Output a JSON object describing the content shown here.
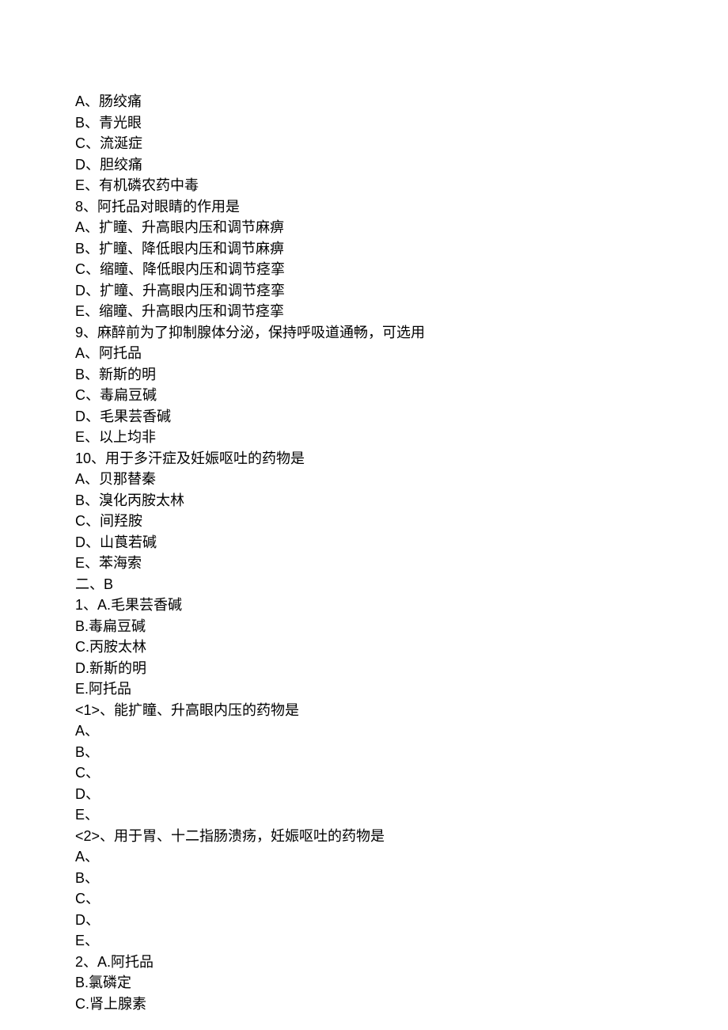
{
  "lines": [
    {
      "prefix": "A、",
      "text": "肠绞痛"
    },
    {
      "prefix": "B、",
      "text": "青光眼"
    },
    {
      "prefix": "C、",
      "text": "流涎症"
    },
    {
      "prefix": "D、",
      "text": "胆绞痛"
    },
    {
      "prefix": "E、",
      "text": "有机磷农药中毒"
    },
    {
      "prefix": "8、",
      "text": "阿托品对眼睛的作用是"
    },
    {
      "prefix": "A、",
      "text": "扩瞳、升高眼内压和调节麻痹"
    },
    {
      "prefix": "B、",
      "text": "扩瞳、降低眼内压和调节麻痹"
    },
    {
      "prefix": "C、",
      "text": "缩瞳、降低眼内压和调节痉挛"
    },
    {
      "prefix": "D、",
      "text": "扩瞳、升高眼内压和调节痉挛"
    },
    {
      "prefix": "E、",
      "text": "缩瞳、升高眼内压和调节痉挛"
    },
    {
      "prefix": "9、",
      "text": "麻醉前为了抑制腺体分泌，保持呼吸道通畅，可选用"
    },
    {
      "prefix": "A、",
      "text": "阿托品"
    },
    {
      "prefix": "B、",
      "text": "新斯的明"
    },
    {
      "prefix": "C、",
      "text": "毒扁豆碱"
    },
    {
      "prefix": "D、",
      "text": "毛果芸香碱"
    },
    {
      "prefix": "E、",
      "text": "以上均非"
    },
    {
      "prefix": "10、",
      "text": "用于多汗症及妊娠呕吐的药物是"
    },
    {
      "prefix": "A、",
      "text": "贝那替秦"
    },
    {
      "prefix": "B、",
      "text": "溴化丙胺太林"
    },
    {
      "prefix": "C、",
      "text": "间羟胺"
    },
    {
      "prefix": "D、",
      "text": "山莨若碱"
    },
    {
      "prefix": "E、",
      "text": "苯海索"
    },
    {
      "prefix": "二、",
      "text": "B",
      "text_arial": true
    },
    {
      "prefix": "1、A.",
      "text": "毛果芸香碱",
      "prefix_mixed": true
    },
    {
      "prefix": "B.",
      "text": "毒扁豆碱"
    },
    {
      "prefix": "C.",
      "text": "丙胺太林"
    },
    {
      "prefix": "D.",
      "text": "新斯的明"
    },
    {
      "prefix": "E.",
      "text": "阿托品"
    },
    {
      "prefix": "<1>、",
      "text": "能扩瞳、升高眼内压的药物是"
    },
    {
      "prefix": "A、",
      "text": ""
    },
    {
      "prefix": "B、",
      "text": ""
    },
    {
      "prefix": "C、",
      "text": ""
    },
    {
      "prefix": "D、",
      "text": ""
    },
    {
      "prefix": "E、",
      "text": ""
    },
    {
      "prefix": "<2>、",
      "text": "用于胃、十二指肠溃疡，妊娠呕吐的药物是"
    },
    {
      "prefix": "A、",
      "text": ""
    },
    {
      "prefix": "B、",
      "text": ""
    },
    {
      "prefix": "C、",
      "text": ""
    },
    {
      "prefix": "D、",
      "text": ""
    },
    {
      "prefix": "E、",
      "text": ""
    },
    {
      "prefix": "2、A.",
      "text": "阿托品",
      "prefix_mixed": true
    },
    {
      "prefix": "B.",
      "text": "氯磷定"
    },
    {
      "prefix": "C.",
      "text": "肾上腺素"
    }
  ]
}
